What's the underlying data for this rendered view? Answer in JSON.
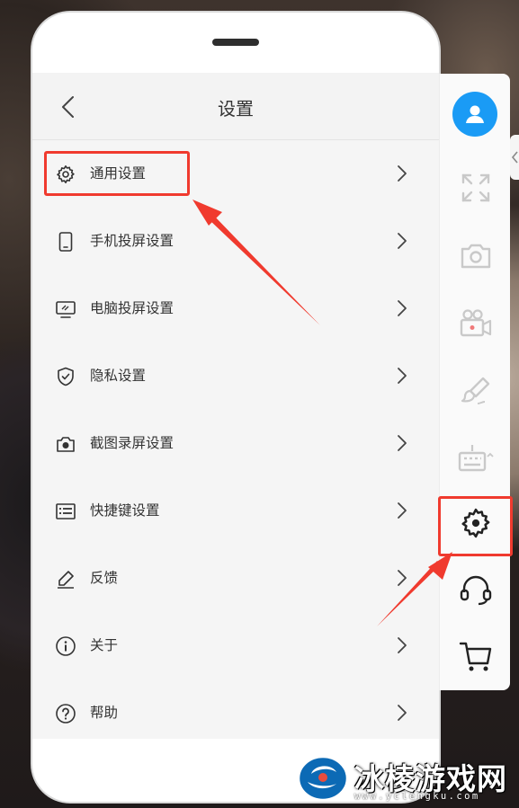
{
  "header": {
    "title": "设置"
  },
  "menu": [
    {
      "label": "通用设置",
      "icon": "gear-icon"
    },
    {
      "label": "手机投屏设置",
      "icon": "phone-icon"
    },
    {
      "label": "电脑投屏设置",
      "icon": "monitor-icon"
    },
    {
      "label": "隐私设置",
      "icon": "shield-check-icon"
    },
    {
      "label": "截图录屏设置",
      "icon": "camera-icon"
    },
    {
      "label": "快捷键设置",
      "icon": "keyboard-shortcut-icon"
    },
    {
      "label": "反馈",
      "icon": "pen-icon"
    },
    {
      "label": "关于",
      "icon": "info-icon"
    },
    {
      "label": "帮助",
      "icon": "help-icon"
    }
  ],
  "toolbar": [
    {
      "name": "avatar",
      "icon": "user-icon"
    },
    {
      "name": "fullscreen",
      "icon": "expand-icon"
    },
    {
      "name": "screenshot",
      "icon": "camera-icon"
    },
    {
      "name": "record",
      "icon": "video-camera-icon"
    },
    {
      "name": "paint",
      "icon": "brush-icon"
    },
    {
      "name": "keyboard",
      "icon": "keyboard-icon"
    },
    {
      "name": "settings",
      "icon": "gear-icon"
    },
    {
      "name": "support",
      "icon": "headset-icon"
    },
    {
      "name": "cart",
      "icon": "cart-icon"
    }
  ],
  "watermark": {
    "title": "冰棱游戏网",
    "url": "www.yclengku.com"
  },
  "colors": {
    "accent": "#1a9bf5",
    "highlight": "#f03a2e"
  }
}
